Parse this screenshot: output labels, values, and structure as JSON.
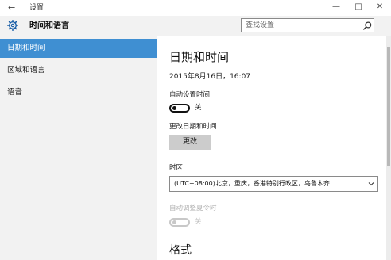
{
  "window": {
    "title": "设置",
    "back_glyph": "←",
    "minimize_glyph": "—",
    "maximize_glyph": "□",
    "close_glyph": "✕"
  },
  "sidebar": {
    "title": "时间和语言",
    "items": [
      {
        "label": "日期和时间",
        "selected": true
      },
      {
        "label": "区域和语言",
        "selected": false
      },
      {
        "label": "语音",
        "selected": false
      }
    ]
  },
  "search": {
    "placeholder": "查找设置"
  },
  "content": {
    "heading": "日期和时间",
    "current_datetime": "2015年8月16日，16:07",
    "auto_time": {
      "label": "自动设置时间",
      "state_label": "关",
      "on": false
    },
    "change": {
      "label": "更改日期和时间",
      "button_label": "更改"
    },
    "timezone": {
      "label": "时区",
      "value": "(UTC+08:00)北京，重庆，香港特别行政区，乌鲁木齐"
    },
    "dst": {
      "label": "自动调整夏令时",
      "state_label": "关",
      "on": false,
      "disabled": true
    },
    "format_heading": "格式"
  },
  "colors": {
    "accent": "#3f8fd2",
    "sidebar_bg": "#f2f2f2",
    "button_bg": "#cccccc"
  }
}
